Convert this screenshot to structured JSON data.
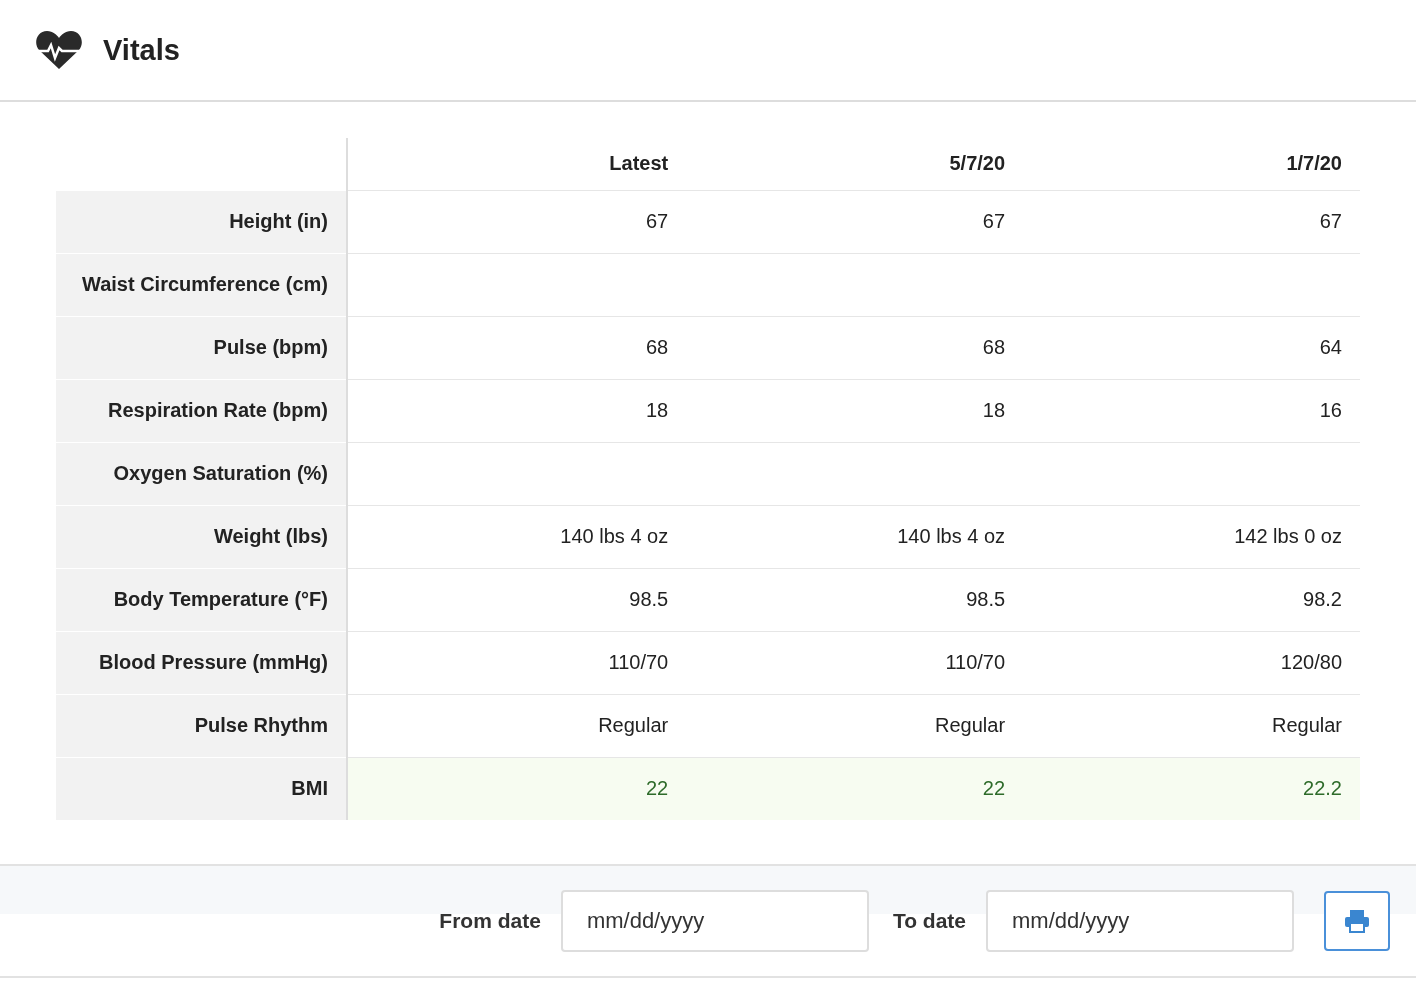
{
  "header": {
    "title": "Vitals"
  },
  "table": {
    "columns": [
      "Latest",
      "5/7/20",
      "1/7/20"
    ],
    "rows": [
      {
        "label": "Height (in)",
        "values": [
          "67",
          "67",
          "67"
        ],
        "highlighted": false
      },
      {
        "label": "Waist Circumference (cm)",
        "highlighted": false
      },
      {
        "label": "Pulse (bpm)",
        "values": [
          "68",
          "68",
          "64"
        ],
        "highlighted": false
      },
      {
        "label": "Respiration Rate (bpm)",
        "values": [
          "18",
          "18",
          "16"
        ],
        "highlighted": false
      },
      {
        "label": "Oxygen Saturation (%)",
        "highlighted": false
      },
      {
        "label": "Weight (lbs)",
        "values": [
          "140 lbs 4 oz",
          "140 lbs 4 oz",
          "142 lbs 0 oz"
        ],
        "highlighted": false
      },
      {
        "label": "Body Temperature (°F)",
        "values": [
          "98.5",
          "98.5",
          "98.2"
        ],
        "highlighted": false
      },
      {
        "label": "Blood Pressure (mmHg)",
        "values": [
          "110/70",
          "110/70",
          "120/80"
        ],
        "highlighted": false
      },
      {
        "label": "Pulse Rhythm",
        "values": [
          "Regular",
          "Regular",
          "Regular"
        ],
        "highlighted": false
      },
      {
        "label": "BMI",
        "values": [
          "22",
          "22",
          "22.2"
        ],
        "highlighted": true
      }
    ]
  },
  "filter": {
    "from_label": "From date",
    "from_placeholder": "mm/dd/yyyy",
    "to_label": "To date",
    "to_placeholder": "mm/dd/yyyy"
  }
}
